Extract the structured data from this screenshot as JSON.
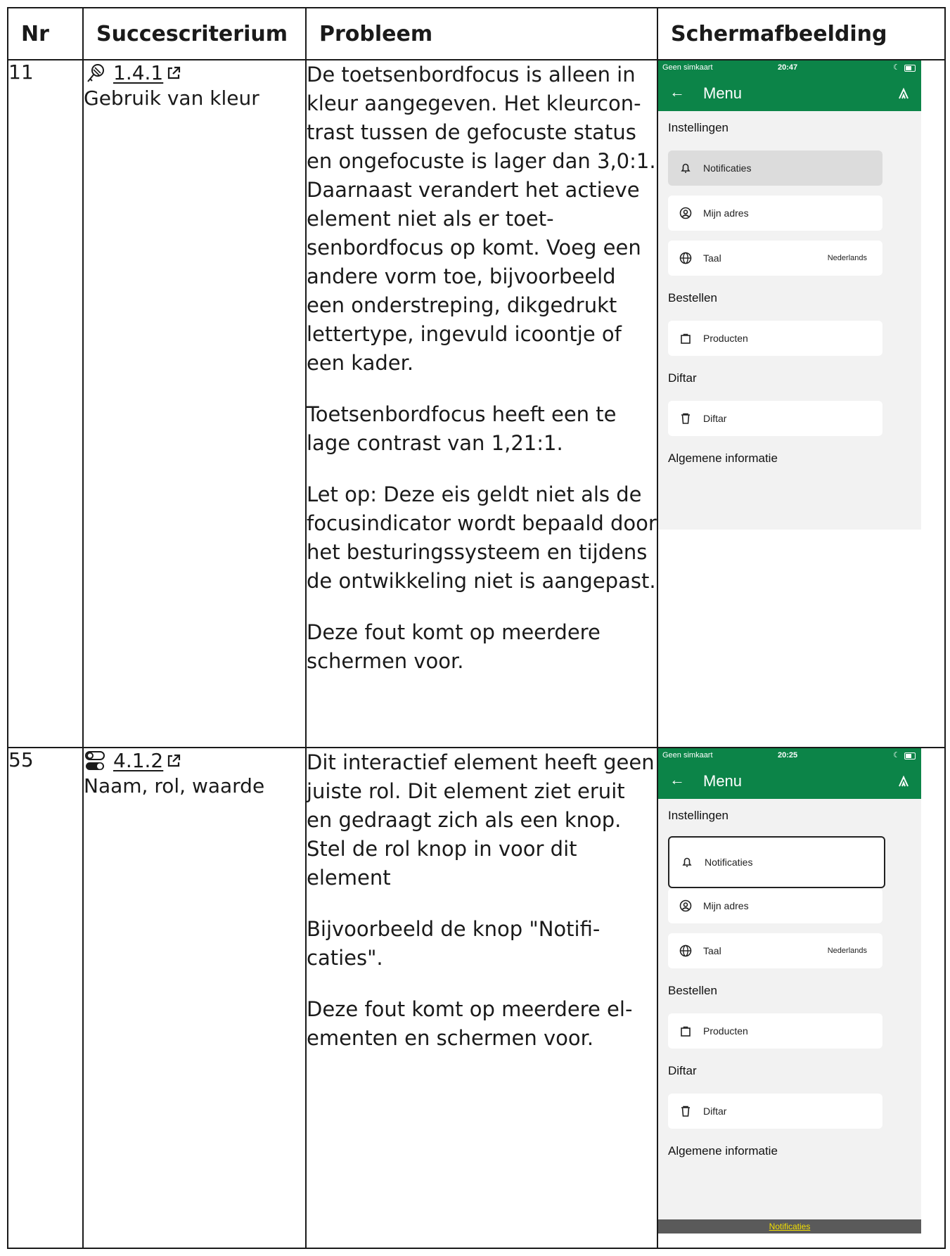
{
  "headers": [
    "Nr",
    "Succescriterium",
    "Probleem",
    "Schermafbeelding"
  ],
  "rows": [
    {
      "nr": "11",
      "criterion_code": "1.4.1",
      "criterion_name": "Gebruik van kleur",
      "criterion_icon": "color-picker-icon",
      "paragraphs": [
        "De toetsenbordfocus is alleen in kleur aangegeven. Het kleurcon­trast tussen de gefocuste status en ongefocuste is lager dan 3,0:1. Daarnaast verandert het actieve element niet als er toet­senbordfocus op komt. Voeg een andere vorm toe, bijvoorbeeld een onderstreping, dikgedrukt lettertype, ingevuld icoontje of een kader.",
        "Toetsenbordfocus heeft een te lage contrast van 1,21:1.",
        "Let op: Deze eis geldt niet als de focusindicator wordt bepaald door het besturingssysteem en tijdens de ontwikkeling niet is aangepast.",
        "Deze fout komt op meerdere schermen voor."
      ],
      "screenshot": {
        "carrier": "Geen simkaart",
        "time": "20:47",
        "title": "Menu",
        "sections": [
          "Instellingen",
          "Bestellen",
          "Diftar",
          "Algemene informatie"
        ],
        "items": [
          "Notificaties",
          "Mijn adres",
          "Taal",
          "Producten",
          "Diftar"
        ],
        "taal_value": "Nederlands"
      }
    },
    {
      "nr": "55",
      "criterion_code": "4.1.2",
      "criterion_name": "Naam, rol, waarde",
      "criterion_icon": "toggle-icon",
      "paragraphs": [
        "Dit interactief element heeft geen juiste rol. Dit element ziet eruit en gedraagt zich als een knop. Stel de rol knop in voor dit element",
        "Bijvoorbeeld de knop \"Notifi­caties\".",
        "Deze fout komt op meerdere el­ementen en schermen voor."
      ],
      "screenshot": {
        "carrier": "Geen simkaart",
        "time": "20:25",
        "title": "Menu",
        "sections": [
          "Instellingen",
          "Bestellen",
          "Diftar",
          "Algemene informatie"
        ],
        "items": [
          "Notificaties",
          "Mijn adres",
          "Taal",
          "Producten",
          "Diftar"
        ],
        "taal_value": "Nederlands",
        "bottom_label": "Notificaties"
      }
    }
  ]
}
